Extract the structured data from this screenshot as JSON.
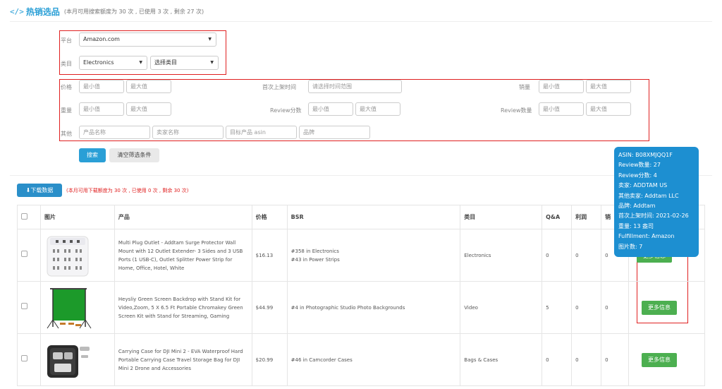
{
  "header": {
    "icon": "code-icon",
    "title": "热销选品",
    "quota": "(本月可用搜索额度为 30 次 , 已使用 3 次 , 剩余 27 次)"
  },
  "filters": {
    "platform_label": "平台",
    "platform_value": "Amazon.com",
    "category_label": "类目",
    "category_value": "Electronics",
    "category_sub": "选择类目",
    "price_label": "价格",
    "min": "最小值",
    "max": "最大值",
    "first_listed_label": "首次上架时间",
    "first_listed_placeholder": "请选择时间范围",
    "sales_label": "销量",
    "weight_label": "重量",
    "review_score_label": "Review分数",
    "review_count_label": "Review数量",
    "other_label": "其他",
    "product_name_ph": "产品名称",
    "seller_name_ph": "卖家名称",
    "target_asin_ph": "目标产品 asin",
    "brand_ph": "品牌"
  },
  "actions": {
    "search": "搜索",
    "clear": "清空筛选条件"
  },
  "download": {
    "label": "下载数据",
    "note": "(本月可用下载额度为 30 次 , 已使用 0 次 , 剩余 30 次)"
  },
  "table": {
    "headers": [
      "图片",
      "产品",
      "价格",
      "BSR",
      "类目",
      "Q&A",
      "利润",
      "销"
    ],
    "more_label": "更多信息",
    "rows": [
      {
        "product": "Multi Plug Outlet - Addtam Surge Protector Wall Mount with 12 Outlet Extender- 3 Sides and 3 USB Ports (1 USB-C), Outlet Splitter Power Strip for Home, Office, Hotel, White",
        "price": "$16.13",
        "bsr": [
          "#358 in Electronics",
          "#43 in Power Strips"
        ],
        "category": "Electronics",
        "qa": "0",
        "profit": "0",
        "sales": "0"
      },
      {
        "product": "Heysliy Green Screen Backdrop with Stand Kit for Video,Zoom, 5 X 6.5 Ft Portable Chromakey Green Screen Kit with Stand for Streaming, Gaming",
        "price": "$44.99",
        "bsr": [
          "#4 in Photographic Studio Photo Backgrounds"
        ],
        "category": "Video",
        "qa": "5",
        "profit": "0",
        "sales": "0"
      },
      {
        "product": "Carrying Case for DJI Mini 2 - EVA Waterproof Hard Portable Carrying Case Travel Storage Bag for DJI Mini 2 Drone and Accessories",
        "price": "$20.99",
        "bsr": [
          "#46 in Camcorder Cases"
        ],
        "category": "Bags & Cases",
        "qa": "0",
        "profit": "0",
        "sales": "0"
      }
    ]
  },
  "tooltip": [
    "ASIN: B08XMJQQ1F",
    "Review数量: 27",
    "Review分数: 4",
    "卖家: ADDTAM US",
    "其他卖家: Addtam LLC",
    "品牌: Addtam",
    "首次上架时间: 2021-02-26",
    "重量: 13 盎司",
    "Fulfillment: Amazon",
    "图片数: 7"
  ],
  "colors": {
    "accent": "#2a9fd6",
    "highlight": "#e02020",
    "more_button": "#4caf50",
    "tooltip_bg": "#1d8fd1"
  }
}
